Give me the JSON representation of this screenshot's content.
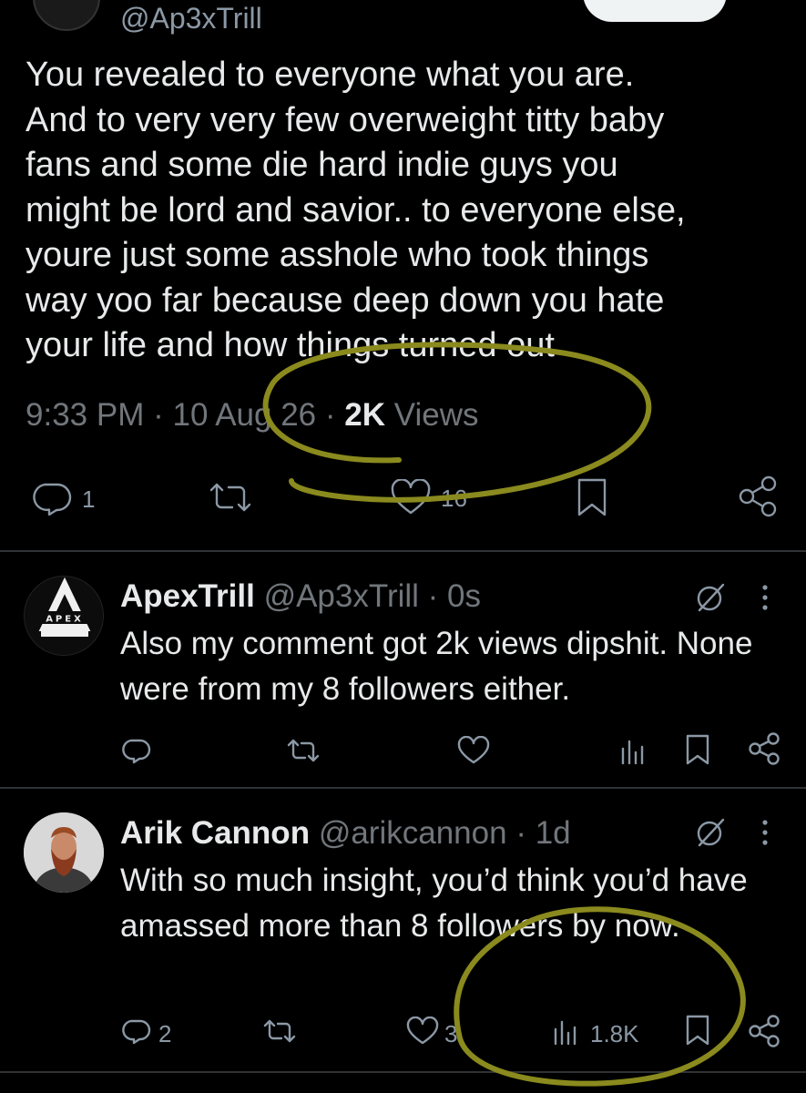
{
  "top": {
    "handle": "@Ap3xTrill"
  },
  "main_tweet": {
    "text": "You revealed to everyone what you are.\nAnd to very very few overweight titty baby\nfans and some die hard indie guys you\nmight be lord and savior.. to everyone else,\nyoure just some asshole who took things\nway yoo far because deep down you hate\nyour life and how things turned out",
    "time": "9:33 PM",
    "sep": "·",
    "date": "10 Aug 26",
    "views_count": "2K",
    "views_label": "Views",
    "reply_count": "1",
    "like_count": "16"
  },
  "replies": [
    {
      "name": "ApexTrill",
      "handle": "@Ap3xTrill",
      "time": "· 0s",
      "avatar_text": "APEX",
      "text": "Also my comment got 2k views dipshit. None were from my 8 followers either."
    },
    {
      "name": "Arik Cannon",
      "handle": "@arikcannon",
      "time": "· 1d",
      "text": "With so much insight, you’d think you’d have amassed more than 8 followers by now.",
      "reply_count": "2",
      "like_count": "3",
      "views_count": "1.8K"
    }
  ],
  "colors": {
    "background": "#000000",
    "text": "#e7e9ea",
    "muted": "#71767b",
    "divider": "#2f3336",
    "highlight": "#8a8a1e"
  }
}
